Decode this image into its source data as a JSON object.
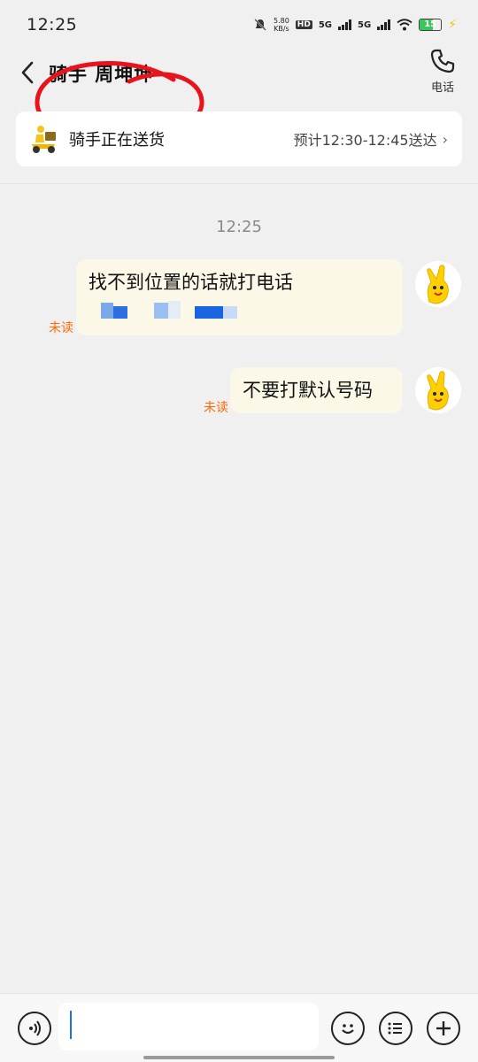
{
  "status_bar": {
    "time": "12:25",
    "net_speed_value": "5.80",
    "net_speed_unit": "KB/s",
    "hd_label": "HD",
    "sim1_label": "5G",
    "sim2_label": "5G",
    "battery": "15"
  },
  "nav": {
    "title": "骑手 周坤坤",
    "phone_label": "电话"
  },
  "delivery": {
    "status": "骑手正在送货",
    "eta": "预计12:30-12:45送达"
  },
  "chat": {
    "timestamp": "12:25",
    "messages": [
      {
        "text": "找不到位置的话就打电话",
        "unread": "未读"
      },
      {
        "text": "不要打默认号码",
        "unread": "未读"
      }
    ]
  },
  "input": {
    "placeholder": ""
  },
  "colors": {
    "bubble": "#fcf8e8",
    "unread": "#ff6a00",
    "annotation": "#e8141c",
    "link_blue": "#1a66e0"
  }
}
